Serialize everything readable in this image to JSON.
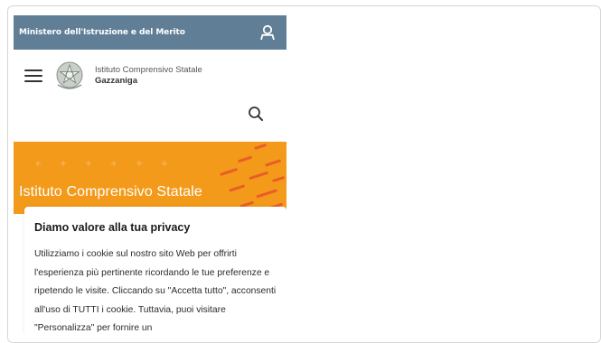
{
  "topbar": {
    "ministry_label": "Ministero dell'Istruzione e del Merito",
    "user_icon": "user-icon"
  },
  "header": {
    "menu_icon": "hamburger-icon",
    "logo": "italian-republic-emblem",
    "school_line1": "Istituto Comprensivo Statale",
    "school_line2": "Gazzaniga",
    "search_icon": "search-icon"
  },
  "hero": {
    "title": "Istituto Comprensivo Statale",
    "accent_color": "#f39a1a"
  },
  "privacy": {
    "title": "Diamo valore alla tua privacy",
    "body": "Utilizziamo i cookie sul nostro sito Web per offrirti l'esperienza più pertinente ricordando le tue preferenze e ripetendo le visite. Cliccando su \"Accetta tutto\", acconsenti all'uso di TUTTI i cookie. Tuttavia, puoi visitare \"Personalizza\" per fornire un"
  },
  "colors": {
    "topbar": "#607f96",
    "hero": "#f39a1a"
  }
}
